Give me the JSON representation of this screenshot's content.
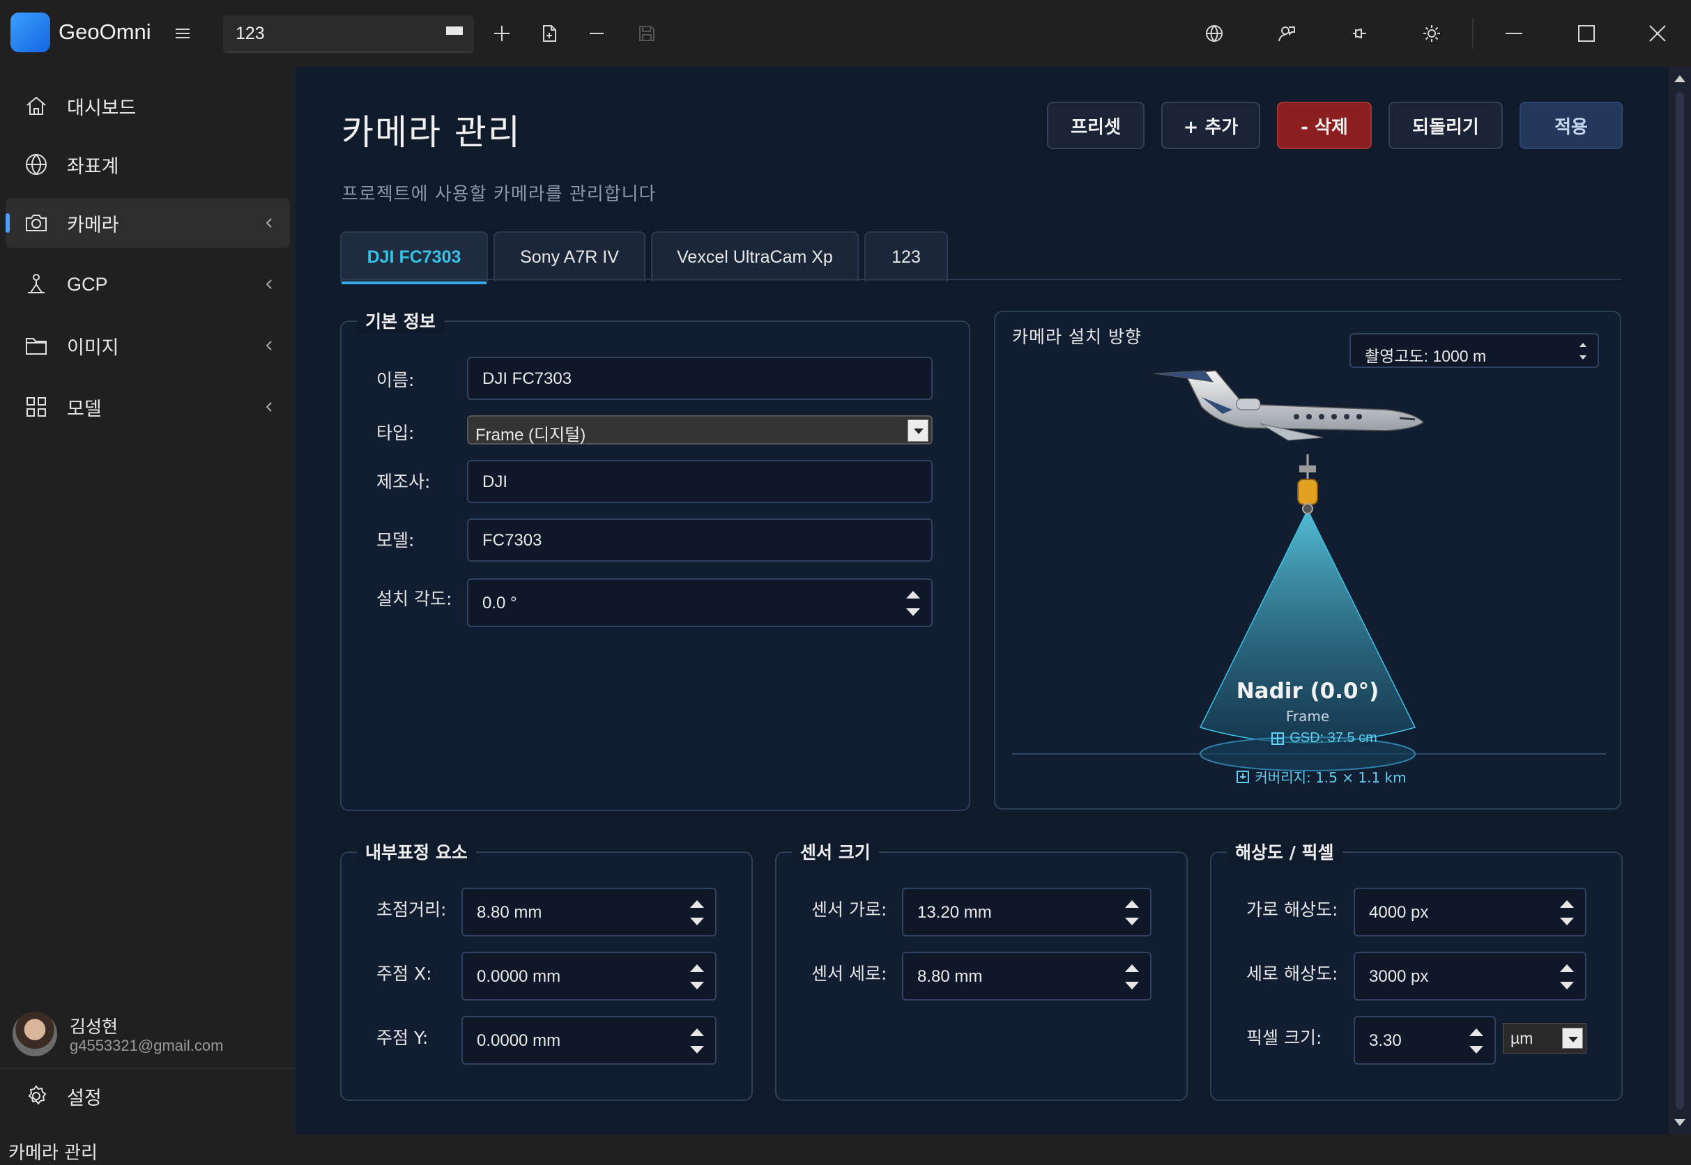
{
  "app": {
    "name": "GeoOmni",
    "project_value": "123"
  },
  "sidebar": {
    "items": [
      {
        "label": "대시보드"
      },
      {
        "label": "좌표계"
      },
      {
        "label": "카메라"
      },
      {
        "label": "GCP"
      },
      {
        "label": "이미지"
      },
      {
        "label": "모델"
      }
    ],
    "user": {
      "name": "김성현",
      "email": "g4553321@gmail.com"
    },
    "settings_label": "설정"
  },
  "status_bar": {
    "text": "카메라 관리"
  },
  "page": {
    "title": "카메라 관리",
    "subtitle": "프로젝트에 사용할 카메라를 관리합니다",
    "buttons": {
      "preset": "프리셋",
      "add": "+ 추가",
      "delete": "- 삭제",
      "revert": "되돌리기",
      "apply": "적용"
    },
    "tabs": [
      "DJI FC7303",
      "Sony A7R IV",
      "Vexcel UltraCam Xp",
      "123"
    ]
  },
  "basic_info": {
    "title": "기본 정보",
    "name_label": "이름:",
    "name_value": "DJI FC7303",
    "type_label": "타입:",
    "type_value": "Frame (디지털)",
    "maker_label": "제조사:",
    "maker_value": "DJI",
    "model_label": "모델:",
    "model_value": "FC7303",
    "angle_label": "설치 각도:",
    "angle_value": "0.0 °"
  },
  "orientation": {
    "title": "카메라 설치 방향",
    "altitude": "촬영고도: 1000 m",
    "nadir": "Nadir (0.0°)",
    "frame": "Frame",
    "gsd": "GSD: 37.5 cm",
    "coverage": "커버리지: 1.5 × 1.1 km"
  },
  "interior": {
    "title": "내부표정 요소",
    "focal_label": "초점거리:",
    "focal_value": "8.80 mm",
    "px_label": "주점 X:",
    "px_value": "0.0000 mm",
    "py_label": "주점 Y:",
    "py_value": "0.0000 mm"
  },
  "sensor": {
    "title": "센서 크기",
    "w_label": "센서 가로:",
    "w_value": "13.20 mm",
    "h_label": "센서 세로:",
    "h_value": "8.80 mm"
  },
  "resolution": {
    "title": "해상도 / 픽셀",
    "w_label": "가로 해상도:",
    "w_value": "4000 px",
    "h_label": "세로 해상도:",
    "h_value": "3000 px",
    "pixel_label": "픽셀 크기:",
    "pixel_value": "3.30",
    "pixel_unit": "µm"
  },
  "colors": {
    "accent": "#36c3e8",
    "danger": "#8b1e1e",
    "primary": "#23385a",
    "main_bg": "#0f1a2b"
  }
}
